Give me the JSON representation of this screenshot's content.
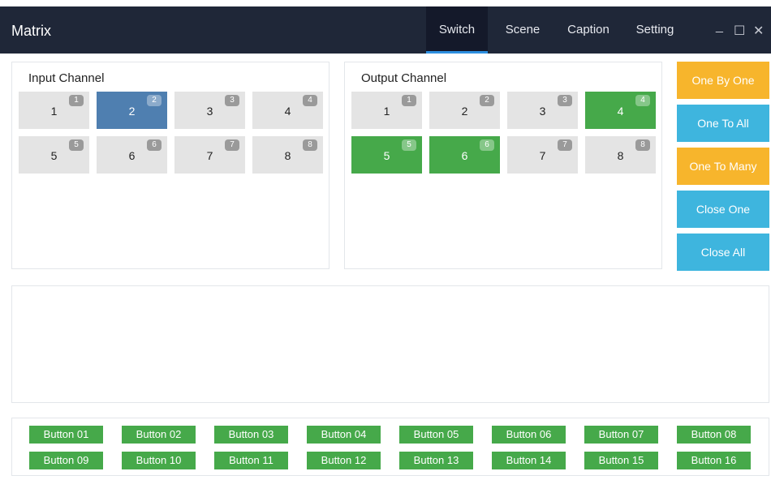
{
  "app": {
    "title": "Matrix"
  },
  "tabs": [
    {
      "label": "Switch",
      "active": true
    },
    {
      "label": "Scene",
      "active": false
    },
    {
      "label": "Caption",
      "active": false
    },
    {
      "label": "Setting",
      "active": false
    }
  ],
  "window_controls": {
    "minimize": "_",
    "maximize": "☐",
    "close": "✕"
  },
  "input_panel": {
    "title": "Input Channel",
    "channels": [
      {
        "label": "1",
        "badge": "1",
        "state": "normal"
      },
      {
        "label": "2",
        "badge": "2",
        "state": "selected"
      },
      {
        "label": "3",
        "badge": "3",
        "state": "normal"
      },
      {
        "label": "4",
        "badge": "4",
        "state": "normal"
      },
      {
        "label": "5",
        "badge": "5",
        "state": "normal"
      },
      {
        "label": "6",
        "badge": "6",
        "state": "normal"
      },
      {
        "label": "7",
        "badge": "7",
        "state": "normal"
      },
      {
        "label": "8",
        "badge": "8",
        "state": "normal"
      }
    ]
  },
  "output_panel": {
    "title": "Output Channel",
    "channels": [
      {
        "label": "1",
        "badge": "1",
        "state": "normal"
      },
      {
        "label": "2",
        "badge": "2",
        "state": "normal"
      },
      {
        "label": "3",
        "badge": "3",
        "state": "normal"
      },
      {
        "label": "4",
        "badge": "4",
        "state": "active"
      },
      {
        "label": "5",
        "badge": "5",
        "state": "active"
      },
      {
        "label": "6",
        "badge": "6",
        "state": "active"
      },
      {
        "label": "7",
        "badge": "7",
        "state": "normal"
      },
      {
        "label": "8",
        "badge": "8",
        "state": "normal"
      }
    ]
  },
  "actions": [
    {
      "label": "One By One",
      "color": "#f7b52c"
    },
    {
      "label": "One To All",
      "color": "#3eb5de"
    },
    {
      "label": "One To Many",
      "color": "#f7b52c"
    },
    {
      "label": "Close One",
      "color": "#3eb5de"
    },
    {
      "label": "Close All",
      "color": "#3eb5de"
    }
  ],
  "custom_buttons": [
    "Button 01",
    "Button 02",
    "Button 03",
    "Button 04",
    "Button 05",
    "Button 06",
    "Button 07",
    "Button 08",
    "Button 09",
    "Button 10",
    "Button 11",
    "Button 12",
    "Button 13",
    "Button 14",
    "Button 15",
    "Button 16"
  ],
  "colors": {
    "titlebar": "#1f2738",
    "tab_active_underline": "#2d8fe0",
    "input_selected": "#4f7fb0",
    "output_active": "#46a94a",
    "custom_button": "#46a94a"
  }
}
